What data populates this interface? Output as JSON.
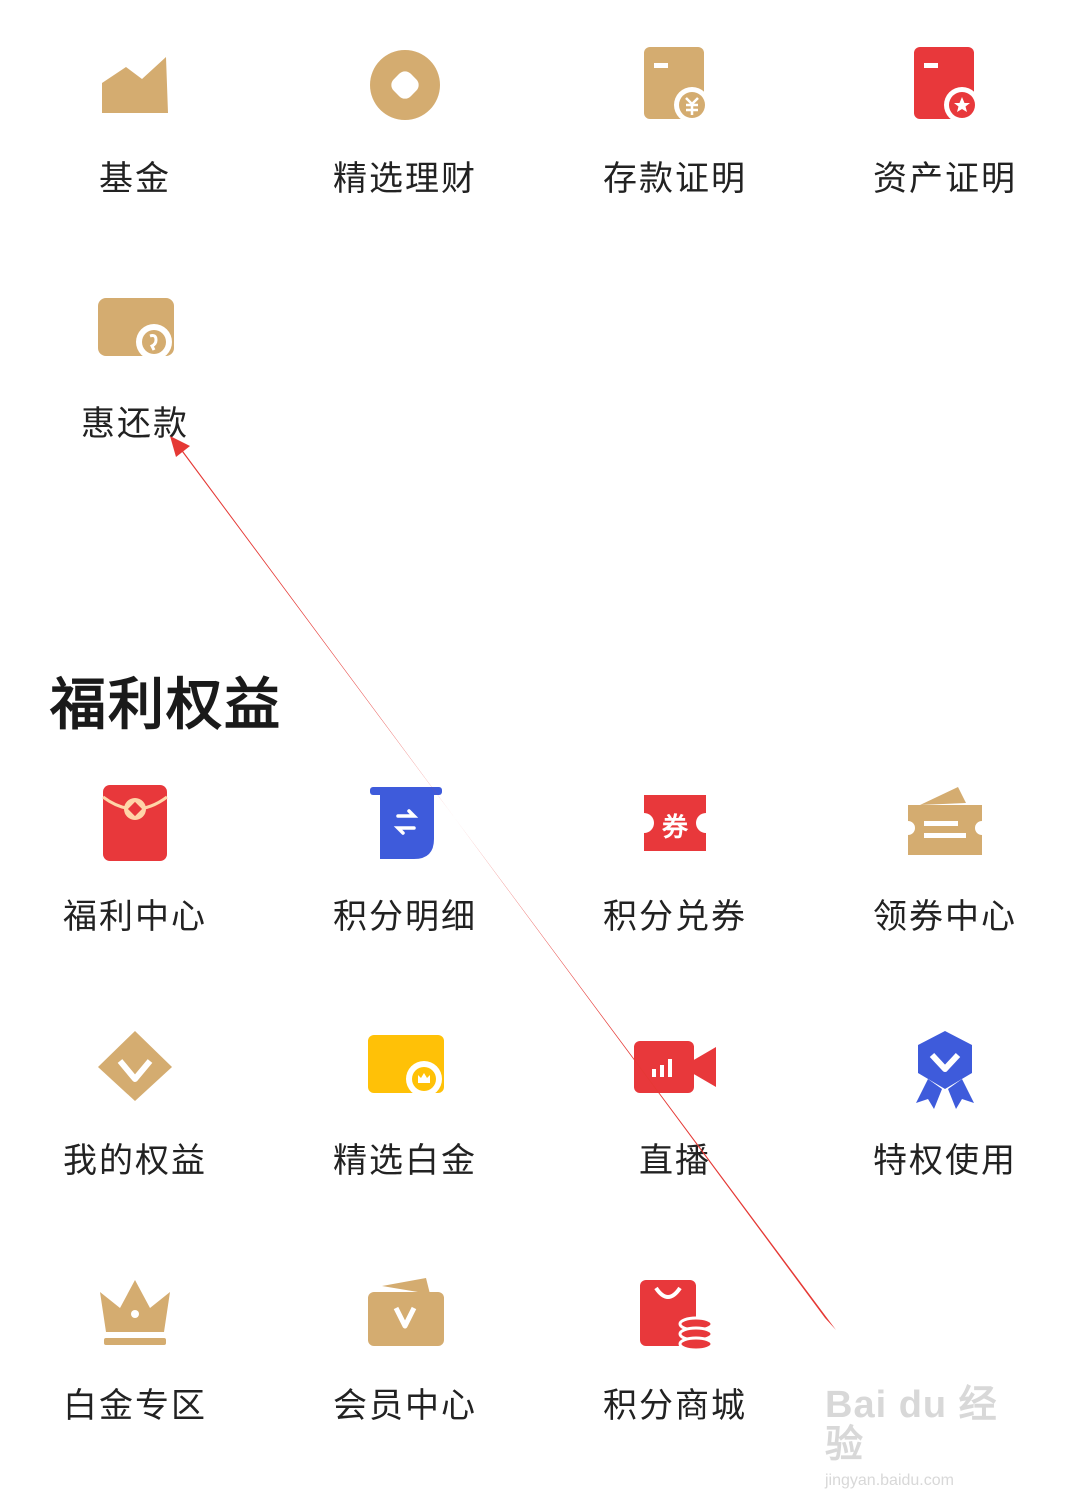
{
  "finance": {
    "items": [
      {
        "label": "基金",
        "icon": "fund-chart-icon"
      },
      {
        "label": "精选理财",
        "icon": "wealth-coin-icon"
      },
      {
        "label": "存款证明",
        "icon": "deposit-certificate-icon"
      },
      {
        "label": "资产证明",
        "icon": "asset-certificate-icon"
      },
      {
        "label": "惠还款",
        "icon": "repayment-wallet-icon"
      }
    ]
  },
  "benefits": {
    "title": "福利权益",
    "items": [
      {
        "label": "福利中心",
        "icon": "red-envelope-icon"
      },
      {
        "label": "积分明细",
        "icon": "points-detail-icon"
      },
      {
        "label": "积分兑券",
        "icon": "coupon-exchange-icon",
        "badge": "券"
      },
      {
        "label": "领券中心",
        "icon": "ticket-icon"
      },
      {
        "label": "我的权益",
        "icon": "diamond-icon"
      },
      {
        "label": "精选白金",
        "icon": "platinum-card-icon"
      },
      {
        "label": "直播",
        "icon": "live-camera-icon"
      },
      {
        "label": "特权使用",
        "icon": "privilege-badge-icon"
      },
      {
        "label": "白金专区",
        "icon": "crown-icon"
      },
      {
        "label": "会员中心",
        "icon": "member-wallet-icon"
      },
      {
        "label": "积分商城",
        "icon": "points-mall-bag-icon"
      }
    ]
  },
  "colors": {
    "gold": "#D4AC70",
    "red": "#E8383B",
    "blue": "#3E5BDB",
    "yellow": "#FFC107",
    "annotation": "#E53935"
  },
  "watermark": {
    "brand": "Bai du 经验",
    "url": "jingyan.baidu.com"
  }
}
